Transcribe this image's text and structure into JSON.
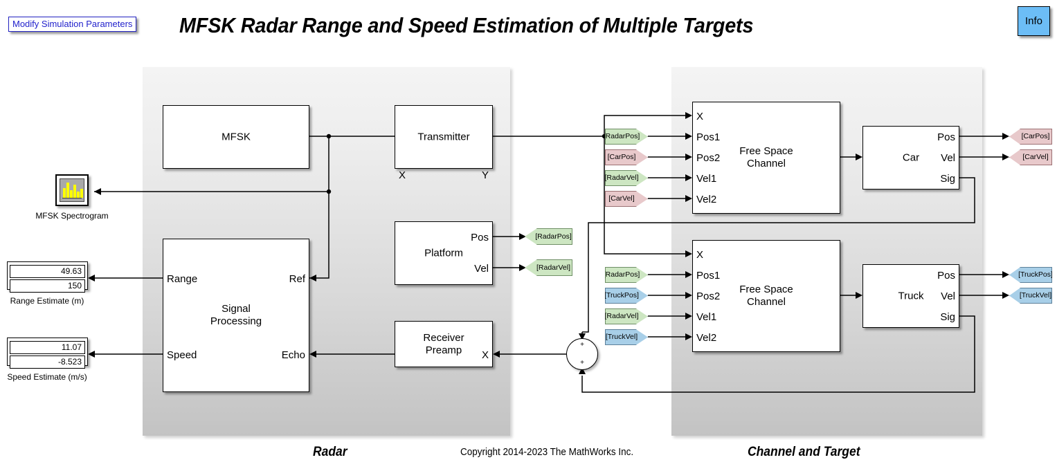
{
  "header": {
    "title": "MFSK Radar Range and Speed Estimation of Multiple Targets",
    "modify_button": "Modify Simulation Parameters",
    "info_button": "Info"
  },
  "footer": {
    "radar_caption": "Radar",
    "channel_caption": "Channel and Target",
    "copyright": "Copyright 2014-2023 The MathWorks Inc."
  },
  "colors": {
    "radar_tag": "#cde6c2",
    "car_tag": "#e8c9cb",
    "truck_tag": "#a8cfe8",
    "info_button": "#6cbdf6",
    "modify_button_text": "#2222cc",
    "scope_trace": "#ffff00"
  },
  "radar_subsystem": {
    "blocks": {
      "mfsk": {
        "name": "MFSK"
      },
      "transmitter": {
        "name": "Transmitter",
        "in": "X",
        "out": "Y"
      },
      "platform": {
        "name": "Platform",
        "out1": "Pos",
        "out2": "Vel"
      },
      "receiver_preamp": {
        "name_line1": "Receiver",
        "name_line2": "Preamp",
        "in": "X"
      },
      "signal_processing": {
        "name_line1": "Signal",
        "name_line2": "Processing",
        "out1": "Range",
        "out2": "Speed",
        "in1": "Ref",
        "in2": "Echo"
      }
    }
  },
  "channel_subsystem": {
    "car_channel": {
      "name_line1": "Free Space",
      "name_line2": "Channel",
      "inputs": [
        "X",
        "Pos1",
        "Pos2",
        "Vel1",
        "Vel2"
      ]
    },
    "truck_channel": {
      "name_line1": "Free Space",
      "name_line2": "Channel",
      "inputs": [
        "X",
        "Pos1",
        "Pos2",
        "Vel1",
        "Vel2"
      ]
    },
    "car": {
      "name": "Car",
      "outputs": [
        "Pos",
        "Vel",
        "Sig"
      ]
    },
    "truck": {
      "name": "Truck",
      "outputs": [
        "Pos",
        "Vel",
        "Sig"
      ]
    }
  },
  "tags": {
    "car_channel_from": [
      "[RadarPos]",
      "[CarPos]",
      "[RadarVel]",
      "[CarVel]"
    ],
    "truck_channel_from": [
      "[RadarPos]",
      "[TruckPos]",
      "[RadarVel]",
      "[TruckVel]"
    ],
    "platform_goto": [
      "[RadarPos]",
      "[RadarVel]"
    ],
    "car_goto": [
      "[CarPos]",
      "[CarVel]"
    ],
    "truck_goto": [
      "[TruckPos]",
      "[TruckVel]"
    ]
  },
  "displays": {
    "spectrogram": {
      "label": "MFSK Spectrogram"
    },
    "range_estimate": {
      "label": "Range Estimate (m)",
      "values": [
        "49.63",
        "150"
      ]
    },
    "speed_estimate": {
      "label": "Speed Estimate (m/s)",
      "values": [
        "11.07",
        "-8.523"
      ]
    }
  },
  "sum_junction": {
    "sign_top": "+",
    "sign_bottom": "+"
  }
}
